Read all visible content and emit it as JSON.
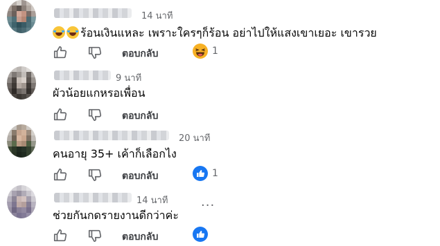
{
  "comments": [
    {
      "time": "14 นาที",
      "text": "ร้อนเงินแหละ เพราะใครๆก็ร้อน อย่าไปให้แสงเขาเยอะ เขารวย",
      "reply_label": "ตอบกลับ",
      "reaction": {
        "type": "haha",
        "count": "1",
        "color": "#f7b125"
      }
    },
    {
      "time": "9 นาที",
      "text": "ผัวน้อยแกหรอเพื่อน",
      "reply_label": "ตอบกลับ"
    },
    {
      "time": "20 นาที",
      "text": "คนอายุ 35+ เค้าก็เลือกไง",
      "reply_label": "ตอบกลับ",
      "reaction": {
        "type": "like",
        "count": "1",
        "color": "#1877f2"
      }
    },
    {
      "time": "14 นาที",
      "text": "ช่วยกันกดรายงานดีกว่าค่ะ",
      "reply_label": "ตอบกลับ",
      "more_label": "···",
      "reaction": {
        "type": "like",
        "count": "",
        "color": "#1877f2"
      }
    }
  ]
}
